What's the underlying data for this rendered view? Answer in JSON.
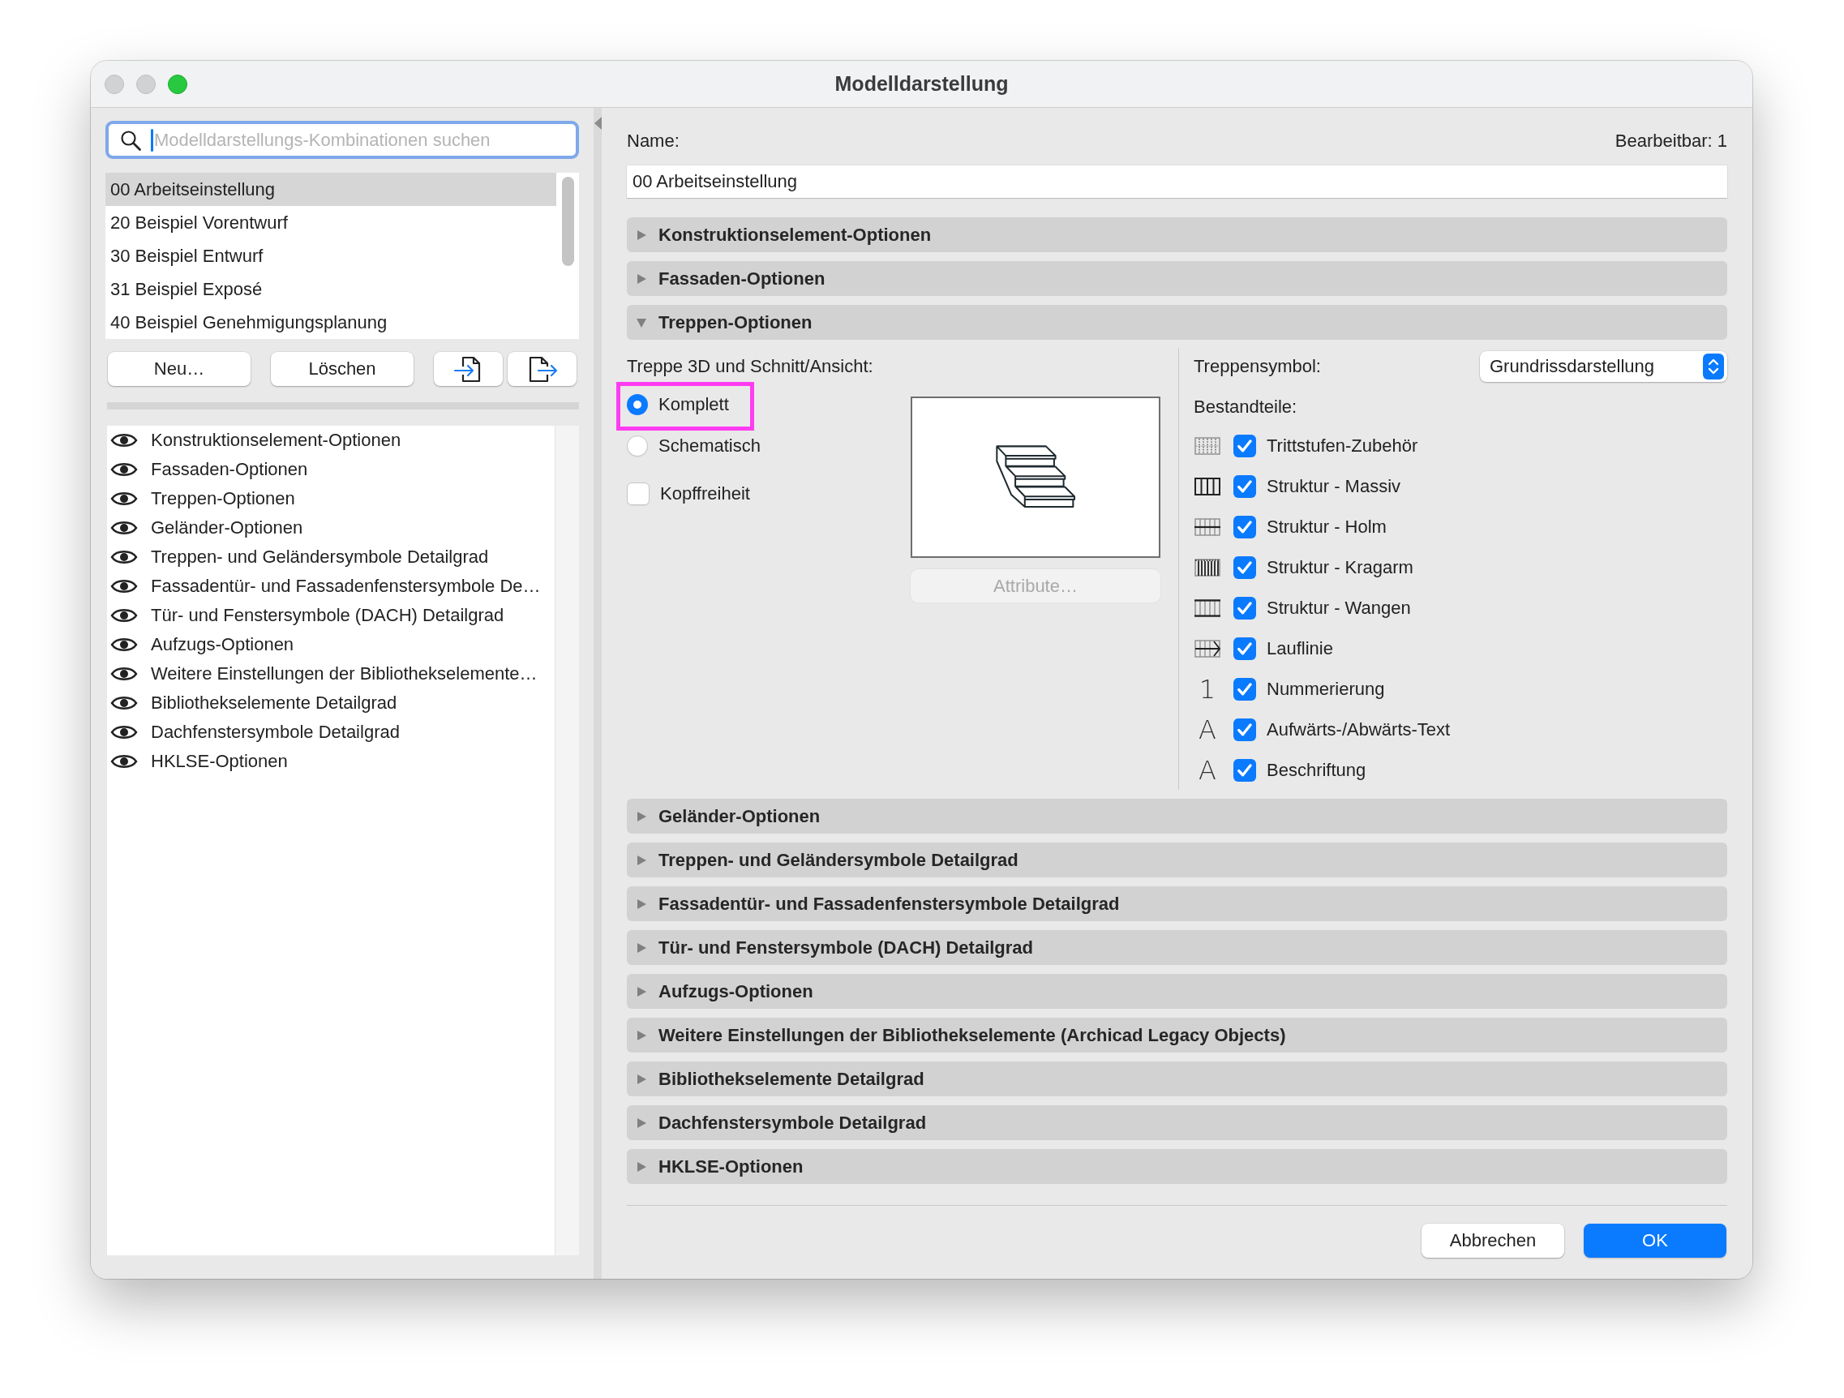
{
  "window": {
    "title": "Modelldarstellung",
    "controls": [
      {
        "kind": "close",
        "disabled": true
      },
      {
        "kind": "minimize",
        "disabled": true
      },
      {
        "kind": "zoom",
        "disabled": false
      }
    ]
  },
  "sidebar": {
    "search": {
      "placeholder": "Modelldarstellungs-Kombinationen suchen",
      "focused": true
    },
    "presets": [
      {
        "label": "00 Arbeitseinstellung",
        "selected": true
      },
      {
        "label": "20 Beispiel Vorentwurf",
        "selected": false
      },
      {
        "label": "30 Beispiel Entwurf",
        "selected": false
      },
      {
        "label": "31 Beispiel Exposé",
        "selected": false
      },
      {
        "label": "40 Beispiel Genehmigungsplanung",
        "selected": false
      }
    ],
    "buttons": [
      {
        "kind": "new",
        "label": "Neu…"
      },
      {
        "kind": "delete",
        "label": "Löschen"
      },
      {
        "kind": "import"
      },
      {
        "kind": "export"
      }
    ],
    "option_sets": [
      {
        "label": "Konstruktionselement-Optionen",
        "visible": true
      },
      {
        "label": "Fassaden-Optionen",
        "visible": true
      },
      {
        "label": "Treppen-Optionen",
        "visible": true
      },
      {
        "label": "Geländer-Optionen",
        "visible": true
      },
      {
        "label": "Treppen- und Geländersymbole Detailgrad",
        "visible": true
      },
      {
        "label": "Fassadentür- und Fassadenfenstersymbole De…",
        "visible": true
      },
      {
        "label": "Tür- und Fenstersymbole (DACH) Detailgrad",
        "visible": true
      },
      {
        "label": "Aufzugs-Optionen",
        "visible": true
      },
      {
        "label": "Weitere Einstellungen der Bibliothekselemente…",
        "visible": true
      },
      {
        "label": "Bibliothekselemente Detailgrad",
        "visible": true
      },
      {
        "label": "Dachfenstersymbole Detailgrad",
        "visible": true
      },
      {
        "label": "HKLSE-Optionen",
        "visible": true
      }
    ]
  },
  "editor": {
    "name_label": "Name:",
    "editable": "Bearbeitbar: 1",
    "name_value": "00 Arbeitseinstellung",
    "sections": [
      {
        "title": "Konstruktionselement-Optionen",
        "expanded": false
      },
      {
        "title": "Fassaden-Optionen",
        "expanded": false
      },
      {
        "title": "Treppen-Optionen",
        "expanded": true,
        "content": {
          "kind": "stairs",
          "view_label": "Treppe 3D und Schnitt/Ansicht:",
          "modes": [
            {
              "label": "Komplett",
              "selected": true,
              "highlighted": true
            },
            {
              "label": "Schematisch",
              "selected": false,
              "highlighted": false
            }
          ],
          "headroom": {
            "label": "Kopffreiheit",
            "checked": false
          },
          "attributes_button": {
            "label": "Attribute…",
            "disabled": true
          },
          "symbol_label": "Treppensymbol:",
          "symbol_value": "Grundrissdarstellung",
          "components_label": "Bestandteile:",
          "components": [
            {
              "kind": "treads",
              "label": "Trittstufen-Zubehör",
              "checked": true
            },
            {
              "kind": "solid",
              "label": "Struktur - Massiv",
              "checked": true
            },
            {
              "kind": "beam",
              "label": "Struktur - Holm",
              "checked": true
            },
            {
              "kind": "cantilever",
              "label": "Struktur - Kragarm",
              "checked": true
            },
            {
              "kind": "stringers",
              "label": "Struktur - Wangen",
              "checked": true
            },
            {
              "kind": "walking_line",
              "label": "Lauflinie",
              "checked": true
            },
            {
              "kind": "number",
              "glyph": "1",
              "label": "Nummerierung",
              "checked": true
            },
            {
              "kind": "text",
              "glyph": "A",
              "label": "Aufwärts-/Abwärts-Text",
              "checked": true
            },
            {
              "kind": "text",
              "glyph": "A",
              "label": "Beschriftung",
              "checked": true
            }
          ]
        }
      },
      {
        "title": "Geländer-Optionen",
        "expanded": false
      },
      {
        "title": "Treppen- und Geländersymbole Detailgrad",
        "expanded": false
      },
      {
        "title": "Fassadentür- und Fassadenfenstersymbole Detailgrad",
        "expanded": false
      },
      {
        "title": "Tür- und Fenstersymbole (DACH) Detailgrad",
        "expanded": false
      },
      {
        "title": "Aufzugs-Optionen",
        "expanded": false
      },
      {
        "title": "Weitere Einstellungen der Bibliothekselemente (Archicad Legacy Objects)",
        "expanded": false
      },
      {
        "title": "Bibliothekselemente Detailgrad",
        "expanded": false
      },
      {
        "title": "Dachfenstersymbole Detailgrad",
        "expanded": false
      },
      {
        "title": "HKLSE-Optionen",
        "expanded": false
      }
    ],
    "buttons": [
      {
        "label": "Abbrechen",
        "default": false
      },
      {
        "label": "OK",
        "default": true
      }
    ]
  }
}
